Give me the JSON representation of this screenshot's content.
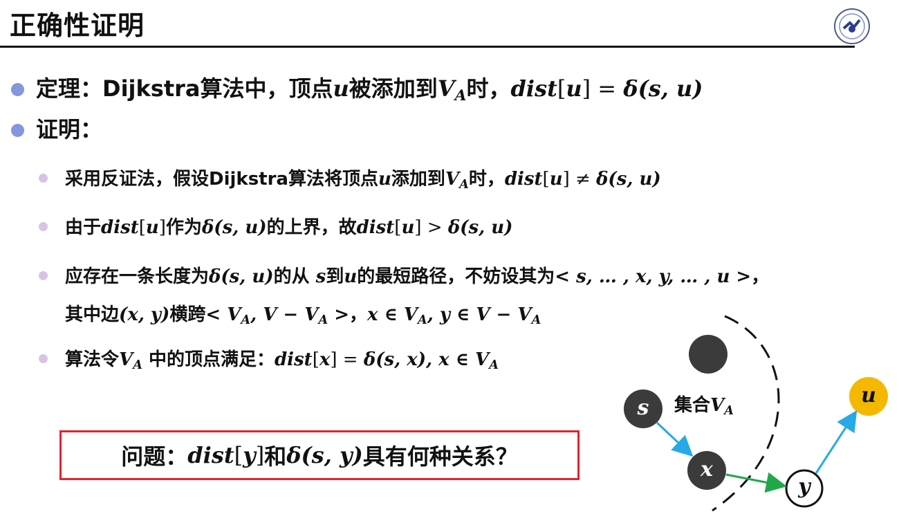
{
  "title": "正确性证明",
  "theorem": {
    "lead": "定理：Dijkstra算法中，顶点",
    "u": "u",
    "mid": "被添加到",
    "V": "V",
    "A": "A",
    "mid2": "时，",
    "dist": "dist",
    "lb": "[",
    "u2": "u",
    "rb": "]",
    "eq": " = ",
    "delta": "δ(s, u)"
  },
  "proof_label": "证明：",
  "items": {
    "i1": {
      "a": "采用反证法，假设Dijkstra算法将顶点",
      "u": "u",
      "b": "添加到",
      "V": "V",
      "A": "A",
      "c": "时，",
      "dist": "dist",
      "lb": "[",
      "u2": "u",
      "rb": "]",
      "neq": " ≠ ",
      "delta": "δ(s, u)"
    },
    "i2": {
      "a": "由于",
      "dist": "dist",
      "lb": "[",
      "u": "u",
      "rb": "]",
      "b": "作为",
      "delta": "δ(s, u)",
      "c": "的上界，故",
      "dist2": "dist",
      "lb2": "[",
      "u2": "u",
      "rb2": "]",
      "gt": " > ",
      "delta2": "δ(s, u)"
    },
    "i3": {
      "a": "应存在一条长度为",
      "delta": "δ(s, u)",
      "b": "的从 ",
      "s": "s",
      "c": "到",
      "u": "u",
      "d": "的最短路径，不妨设其为",
      "path": "< s, … , x, y, … , u >",
      "e": "，"
    },
    "i3b": {
      "a": "其中边",
      "xy": "(x, y)",
      "b": "横跨",
      "cut": "< V",
      "A1": "A",
      "cut2": ", V − V",
      "A2": "A",
      "cut3": " >",
      "c": "，",
      "x": "x ∈ V",
      "A3": "A",
      "y": ", y ∈ V − V",
      "A4": "A"
    },
    "i4": {
      "a": "算法令",
      "V": "V",
      "A": "A",
      "b": " 中的顶点满足：",
      "dist": "dist",
      "lb": "[",
      "x": "x",
      "rb": "]",
      "eq": " = ",
      "delta": "δ(s, x), x ∈ V",
      "A2": "A"
    }
  },
  "question": {
    "a": "问题：",
    "dist": "dist",
    "lb": "[",
    "y": "y",
    "rb": "]",
    "b": "和",
    "delta": "δ(s, y)",
    "c": "具有何种关系？"
  },
  "diagram": {
    "set_label": "集合",
    "set_V": "V",
    "set_A": "A",
    "nodes": {
      "s": "s",
      "x": "x",
      "y": "y",
      "u": "u"
    },
    "colors": {
      "node_dark": "#3b3b3b",
      "node_u": "#f5b800",
      "edge_blue": "#27a9e6",
      "edge_green": "#1fa84a",
      "box_red": "#e8212c"
    }
  }
}
